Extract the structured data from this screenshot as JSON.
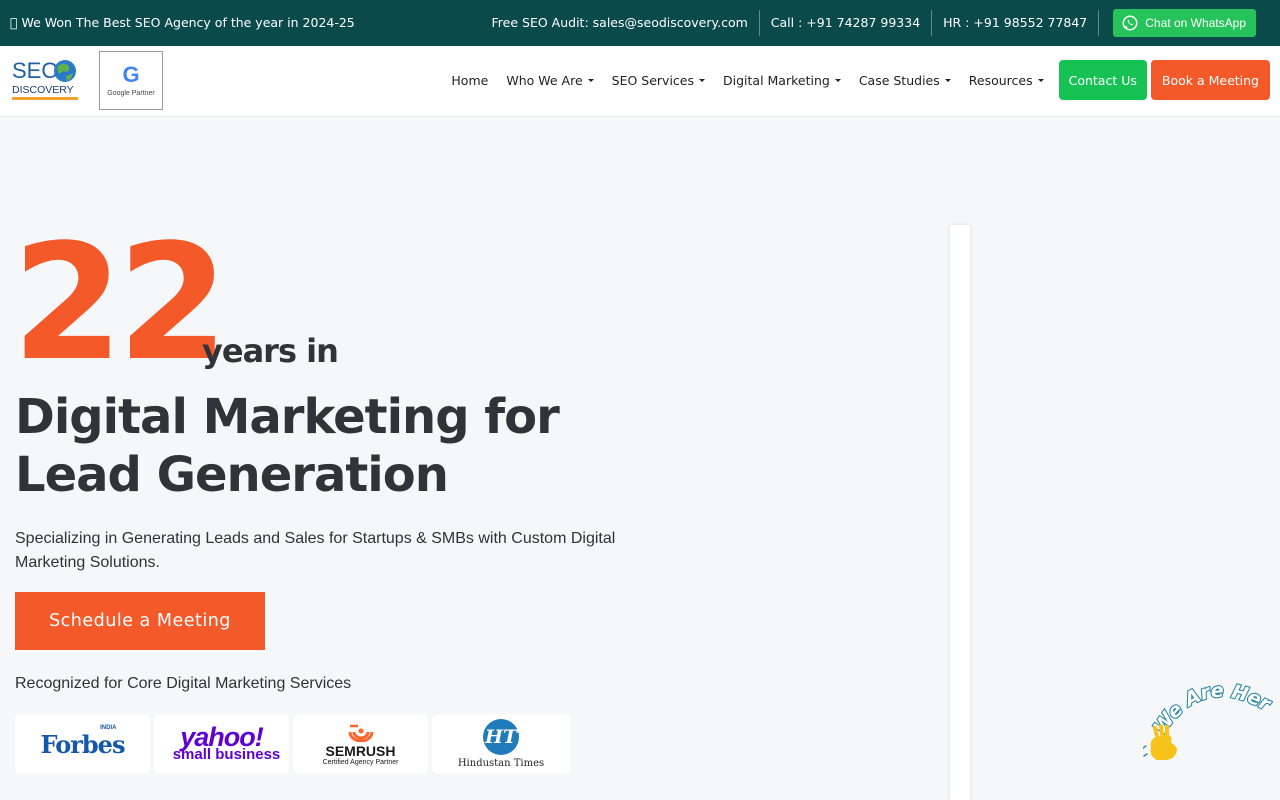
{
  "topbar": {
    "award": "\u0000 We Won The Best SEO Agency of the year in 2024-25",
    "audit": "Free SEO Audit: sales@seodiscovery.com",
    "call": "Call : +91 74287 99334",
    "hr": "HR : +91 98552 77847",
    "whatsapp": "Chat on WhatsApp",
    "bg_color": "#0a4a4a",
    "whatsapp_color": "#25c35a"
  },
  "logo": {
    "line1": "SEO",
    "line2": "DISCOVERY",
    "icon": "globe-icon"
  },
  "partner": {
    "letter": "G",
    "label": "Google Partner"
  },
  "nav": {
    "items": [
      {
        "label": "Home",
        "dropdown": false
      },
      {
        "label": "Who We Are",
        "dropdown": true
      },
      {
        "label": "SEO Services",
        "dropdown": true
      },
      {
        "label": "Digital Marketing",
        "dropdown": true
      },
      {
        "label": "Case Studies",
        "dropdown": true
      },
      {
        "label": "Resources",
        "dropdown": true
      }
    ],
    "contact": "Contact Us",
    "book": "Book a Meeting",
    "contact_color": "#16c253",
    "book_color": "#f4592a"
  },
  "hero": {
    "number": "22",
    "years": "years in",
    "headline": "Digital Marketing for Lead Generation",
    "sub": "Specializing in Generating Leads and Sales for Startups & SMBs with Custom Digital Marketing Solutions.",
    "cta": "Schedule a Meeting",
    "recognized": "Recognized for Core Digital Marketing Services",
    "accent_color": "#f4592a"
  },
  "brands": {
    "forbes": {
      "name": "Forbes",
      "tag": "INDIA"
    },
    "yahoo": {
      "line1": "yahoo!",
      "line2": "small business"
    },
    "semrush": {
      "name": "SEMRUSH",
      "sub": "Certified Agency Partner"
    },
    "ht": {
      "badge": "HT",
      "name": "Hindustan Times"
    }
  },
  "widget": {
    "text": "We Are Here!",
    "icon": "waving-hand-icon"
  }
}
